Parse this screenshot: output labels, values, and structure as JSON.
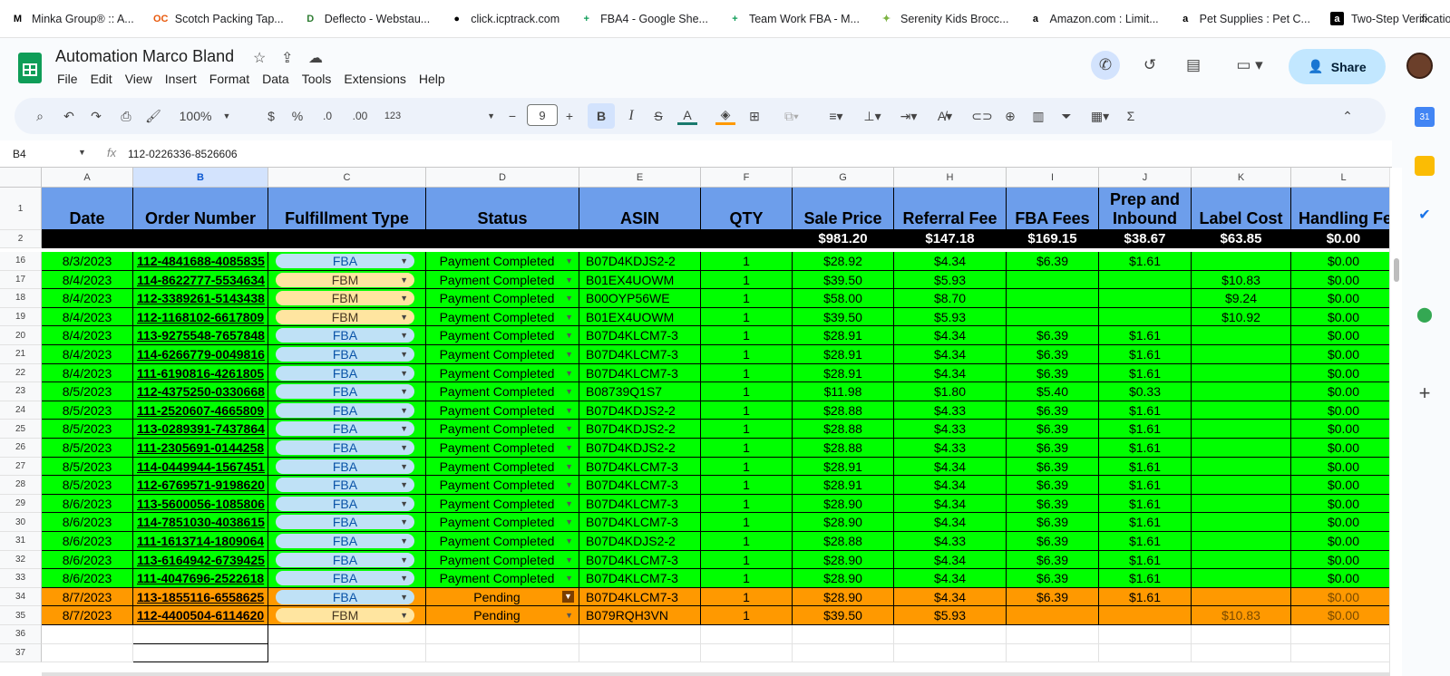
{
  "bookmarks": [
    {
      "icon": "M",
      "label": "Minka Group® :: A..."
    },
    {
      "icon": "OC",
      "label": "Scotch Packing Tap..."
    },
    {
      "icon": "D",
      "label": "Deflecto - Webstau..."
    },
    {
      "icon": "●",
      "label": "click.icptrack.com"
    },
    {
      "icon": "+",
      "label": "FBA4 - Google She..."
    },
    {
      "icon": "+",
      "label": "Team Work FBA - M..."
    },
    {
      "icon": "✦",
      "label": "Serenity Kids Brocc..."
    },
    {
      "icon": "a",
      "label": "Amazon.com : Limit..."
    },
    {
      "icon": "a",
      "label": "Pet Supplies : Pet C..."
    },
    {
      "icon": "a",
      "label": "Two-Step Verification"
    }
  ],
  "bookmarks_more": "»",
  "doc": {
    "title": "Automation Marco Bland"
  },
  "menus": [
    "File",
    "Edit",
    "View",
    "Insert",
    "Format",
    "Data",
    "Tools",
    "Extensions",
    "Help"
  ],
  "share_label": "Share",
  "toolbar": {
    "zoom": "100%",
    "currency": "$",
    "percent": "%",
    "dec_minus": ".0",
    "dec_plus": ".00",
    "more_formats": "123",
    "font_size": "9",
    "bold": "B",
    "italic": "I",
    "text_color": "A",
    "sum": "Σ"
  },
  "formula_bar": {
    "cell": "B4",
    "fx": "fx",
    "value": "112-0226336-8526606"
  },
  "columns": [
    {
      "letter": "A",
      "header": "Date"
    },
    {
      "letter": "B",
      "header": "Order Number"
    },
    {
      "letter": "C",
      "header": "Fulfillment Type"
    },
    {
      "letter": "D",
      "header": "Status"
    },
    {
      "letter": "E",
      "header": "ASIN"
    },
    {
      "letter": "F",
      "header": "QTY"
    },
    {
      "letter": "G",
      "header": "Sale Price"
    },
    {
      "letter": "H",
      "header": "Referral Fee"
    },
    {
      "letter": "I",
      "header": "FBA  Fees"
    },
    {
      "letter": "J",
      "header": "Prep and Inbound"
    },
    {
      "letter": "K",
      "header": "Label Cost"
    },
    {
      "letter": "L",
      "header": "Handling Fe"
    }
  ],
  "header_row_num": "1",
  "totals": {
    "row_num": "2",
    "values": [
      "",
      "",
      "",
      "",
      "",
      "",
      "$981.20",
      "$147.18",
      "$169.15",
      "$38.67",
      "$63.85",
      "$0.00"
    ]
  },
  "rows": [
    {
      "n": "16",
      "date": "8/3/2023",
      "order": "112-4841688-4085835",
      "type": "FBA",
      "status": "Payment Completed",
      "asin": "B07D4KDJS2-2",
      "qty": "1",
      "sale": "$28.92",
      "ref": "$4.34",
      "fba": "$6.39",
      "prep": "$1.61",
      "label": "",
      "handling": "$0.00",
      "color": "g"
    },
    {
      "n": "17",
      "date": "8/4/2023",
      "order": "114-8622777-5534634",
      "type": "FBM",
      "status": "Payment Completed",
      "asin": "B01EX4UOWM",
      "qty": "1",
      "sale": "$39.50",
      "ref": "$5.93",
      "fba": "",
      "prep": "",
      "label": "$10.83",
      "handling": "$0.00",
      "color": "g"
    },
    {
      "n": "18",
      "date": "8/4/2023",
      "order": "112-3389261-5143438",
      "type": "FBM",
      "status": "Payment Completed",
      "asin": "B00OYP56WE",
      "qty": "1",
      "sale": "$58.00",
      "ref": "$8.70",
      "fba": "",
      "prep": "",
      "label": "$9.24",
      "handling": "$0.00",
      "color": "g"
    },
    {
      "n": "19",
      "date": "8/4/2023",
      "order": "112-1168102-6617809",
      "type": "FBM",
      "status": "Payment Completed",
      "asin": "B01EX4UOWM",
      "qty": "1",
      "sale": "$39.50",
      "ref": "$5.93",
      "fba": "",
      "prep": "",
      "label": "$10.92",
      "handling": "$0.00",
      "color": "g"
    },
    {
      "n": "20",
      "date": "8/4/2023",
      "order": "113-9275548-7657848",
      "type": "FBA",
      "status": "Payment Completed",
      "asin": "B07D4KLCM7-3",
      "qty": "1",
      "sale": "$28.91",
      "ref": "$4.34",
      "fba": "$6.39",
      "prep": "$1.61",
      "label": "",
      "handling": "$0.00",
      "color": "g"
    },
    {
      "n": "21",
      "date": "8/4/2023",
      "order": "114-6266779-0049816",
      "type": "FBA",
      "status": "Payment Completed",
      "asin": "B07D4KLCM7-3",
      "qty": "1",
      "sale": "$28.91",
      "ref": "$4.34",
      "fba": "$6.39",
      "prep": "$1.61",
      "label": "",
      "handling": "$0.00",
      "color": "g"
    },
    {
      "n": "22",
      "date": "8/4/2023",
      "order": "111-6190816-4261805",
      "type": "FBA",
      "status": "Payment Completed",
      "asin": "B07D4KLCM7-3",
      "qty": "1",
      "sale": "$28.91",
      "ref": "$4.34",
      "fba": "$6.39",
      "prep": "$1.61",
      "label": "",
      "handling": "$0.00",
      "color": "g"
    },
    {
      "n": "23",
      "date": "8/5/2023",
      "order": "112-4375250-0330668",
      "type": "FBA",
      "status": "Payment Completed",
      "asin": "B08739Q1S7",
      "qty": "1",
      "sale": "$11.98",
      "ref": "$1.80",
      "fba": "$5.40",
      "prep": "$0.33",
      "label": "",
      "handling": "$0.00",
      "color": "g"
    },
    {
      "n": "24",
      "date": "8/5/2023",
      "order": "111-2520607-4665809",
      "type": "FBA",
      "status": "Payment Completed",
      "asin": "B07D4KDJS2-2",
      "qty": "1",
      "sale": "$28.88",
      "ref": "$4.33",
      "fba": "$6.39",
      "prep": "$1.61",
      "label": "",
      "handling": "$0.00",
      "color": "g"
    },
    {
      "n": "25",
      "date": "8/5/2023",
      "order": "113-0289391-7437864",
      "type": "FBA",
      "status": "Payment Completed",
      "asin": "B07D4KDJS2-2",
      "qty": "1",
      "sale": "$28.88",
      "ref": "$4.33",
      "fba": "$6.39",
      "prep": "$1.61",
      "label": "",
      "handling": "$0.00",
      "color": "g"
    },
    {
      "n": "26",
      "date": "8/5/2023",
      "order": "111-2305691-0144258",
      "type": "FBA",
      "status": "Payment Completed",
      "asin": "B07D4KDJS2-2",
      "qty": "1",
      "sale": "$28.88",
      "ref": "$4.33",
      "fba": "$6.39",
      "prep": "$1.61",
      "label": "",
      "handling": "$0.00",
      "color": "g"
    },
    {
      "n": "27",
      "date": "8/5/2023",
      "order": "114-0449944-1567451",
      "type": "FBA",
      "status": "Payment Completed",
      "asin": "B07D4KLCM7-3",
      "qty": "1",
      "sale": "$28.91",
      "ref": "$4.34",
      "fba": "$6.39",
      "prep": "$1.61",
      "label": "",
      "handling": "$0.00",
      "color": "g"
    },
    {
      "n": "28",
      "date": "8/5/2023",
      "order": "112-6769571-9198620",
      "type": "FBA",
      "status": "Payment Completed",
      "asin": "B07D4KLCM7-3",
      "qty": "1",
      "sale": "$28.91",
      "ref": "$4.34",
      "fba": "$6.39",
      "prep": "$1.61",
      "label": "",
      "handling": "$0.00",
      "color": "g"
    },
    {
      "n": "29",
      "date": "8/6/2023",
      "order": "113-5600056-1085806",
      "type": "FBA",
      "status": "Payment Completed",
      "asin": "B07D4KLCM7-3",
      "qty": "1",
      "sale": "$28.90",
      "ref": "$4.34",
      "fba": "$6.39",
      "prep": "$1.61",
      "label": "",
      "handling": "$0.00",
      "color": "g"
    },
    {
      "n": "30",
      "date": "8/6/2023",
      "order": "114-7851030-4038615",
      "type": "FBA",
      "status": "Payment Completed",
      "asin": "B07D4KLCM7-3",
      "qty": "1",
      "sale": "$28.90",
      "ref": "$4.34",
      "fba": "$6.39",
      "prep": "$1.61",
      "label": "",
      "handling": "$0.00",
      "color": "g"
    },
    {
      "n": "31",
      "date": "8/6/2023",
      "order": "111-1613714-1809064",
      "type": "FBA",
      "status": "Payment Completed",
      "asin": "B07D4KDJS2-2",
      "qty": "1",
      "sale": "$28.88",
      "ref": "$4.33",
      "fba": "$6.39",
      "prep": "$1.61",
      "label": "",
      "handling": "$0.00",
      "color": "g"
    },
    {
      "n": "32",
      "date": "8/6/2023",
      "order": "113-6164942-6739425",
      "type": "FBA",
      "status": "Payment Completed",
      "asin": "B07D4KLCM7-3",
      "qty": "1",
      "sale": "$28.90",
      "ref": "$4.34",
      "fba": "$6.39",
      "prep": "$1.61",
      "label": "",
      "handling": "$0.00",
      "color": "g"
    },
    {
      "n": "33",
      "date": "8/6/2023",
      "order": "111-4047696-2522618",
      "type": "FBA",
      "status": "Payment Completed",
      "asin": "B07D4KLCM7-3",
      "qty": "1",
      "sale": "$28.90",
      "ref": "$4.34",
      "fba": "$6.39",
      "prep": "$1.61",
      "label": "",
      "handling": "$0.00",
      "color": "g"
    },
    {
      "n": "34",
      "date": "8/7/2023",
      "order": "113-1855116-6558625",
      "type": "FBA",
      "status": "Pending",
      "asin": "B07D4KLCM7-3",
      "qty": "1",
      "sale": "$28.90",
      "ref": "$4.34",
      "fba": "$6.39",
      "prep": "$1.61",
      "label": "",
      "handling": "$0.00",
      "color": "o",
      "box": true
    },
    {
      "n": "35",
      "date": "8/7/2023",
      "order": "112-4400504-6114620",
      "type": "FBM",
      "status": "Pending",
      "asin": "B079RQH3VN",
      "qty": "1",
      "sale": "$39.50",
      "ref": "$5.93",
      "fba": "",
      "prep": "",
      "label": "$10.83",
      "handling": "$0.00",
      "color": "o"
    }
  ],
  "empty_rows": [
    "36",
    "37"
  ],
  "colors": {
    "green": "#00ff00",
    "orange": "#ff9900",
    "header_blue": "#6d9eeb",
    "fba_chip": "#bfe1f6",
    "fbm_chip": "#ffe5a0"
  }
}
